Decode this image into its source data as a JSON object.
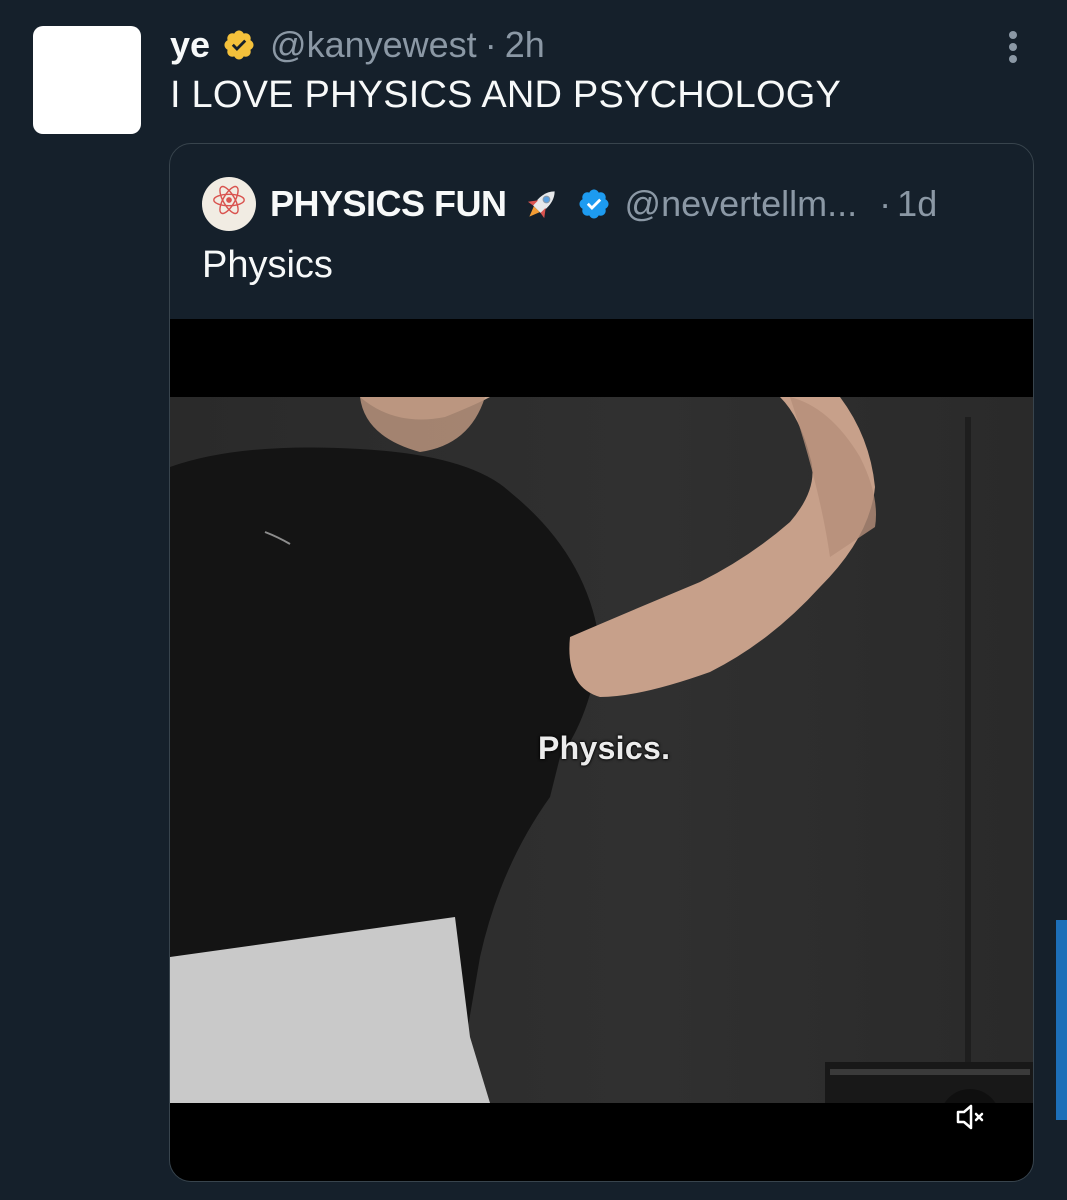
{
  "tweet": {
    "display_name": "ye",
    "handle": "@kanyewest",
    "separator": "·",
    "time": "2h",
    "text": "I LOVE PHYSICS AND PSYCHOLOGY",
    "badge_color": "#f4c13b"
  },
  "quote": {
    "display_name": "PHYSICS FUN",
    "handle": "@nevertellm...",
    "separator": "·",
    "time": "1d",
    "text": "Physics",
    "badge_color": "#1d9bf0"
  },
  "video": {
    "caption": "Physics.",
    "muted": true
  },
  "icons": {
    "more": "more-vertical-icon",
    "rocket": "rocket-icon",
    "mute": "volume-mute-icon",
    "atom": "atom-icon"
  }
}
